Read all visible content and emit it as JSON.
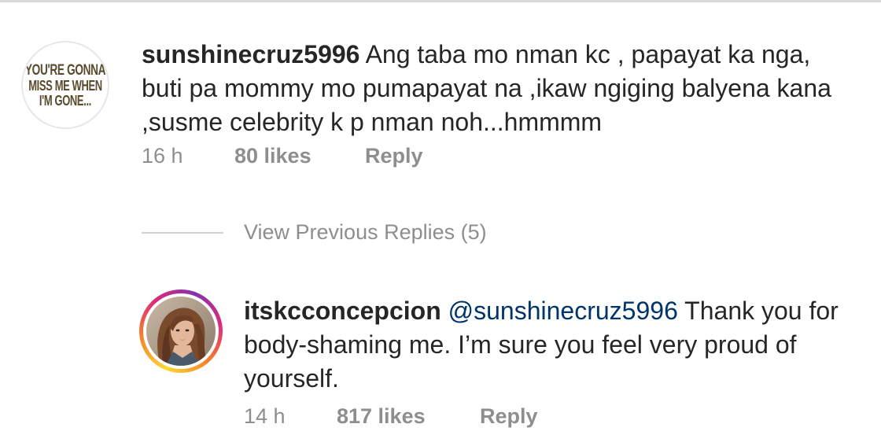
{
  "comments": [
    {
      "username": "sunshinecruz5996",
      "text": "Ang taba mo nman kc , papayat ka nga, buti pa mommy mo pumapayat na ,ikaw ngiging balyena kana ,susme celebrity k p nman noh...hmmmm",
      "time": "16 h",
      "likes": "80 likes",
      "reply_label": "Reply",
      "avatar_text": [
        "YOU'RE GONNA",
        "MISS ME WHEN",
        "I'M GONE..."
      ]
    }
  ],
  "view_previous_replies": "View Previous Replies (5)",
  "replies": [
    {
      "username": "itskcconcepcion",
      "mention": "@sunshinecruz5996",
      "text": "Thank you for body-shaming me. I’m sure you feel very proud of yourself.",
      "time": "14 h",
      "likes": "817 likes",
      "reply_label": "Reply",
      "avatar_ring_colors": [
        "#fdd835",
        "#f58529",
        "#dd2a7b",
        "#8134af"
      ]
    }
  ]
}
